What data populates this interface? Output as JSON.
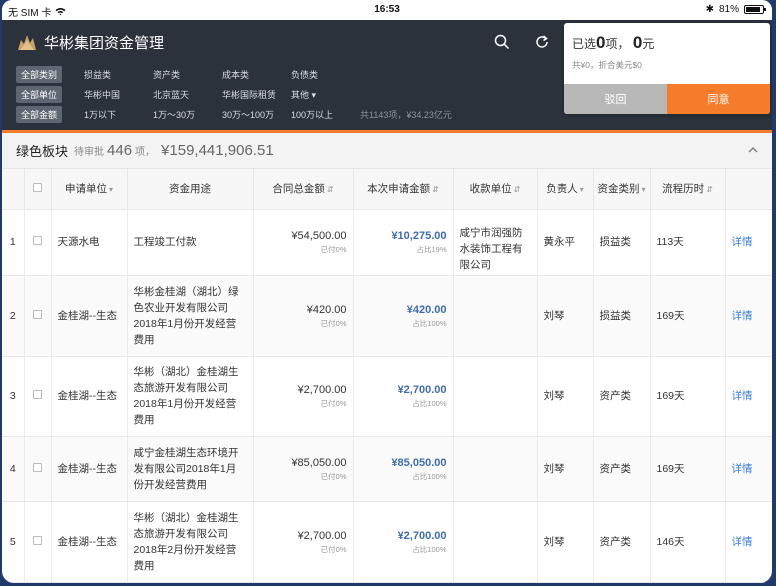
{
  "status": {
    "carrier": "无 SIM 卡",
    "time": "16:53",
    "battery": "81%"
  },
  "app": {
    "title": "华彬集团资金管理"
  },
  "filters": {
    "category": {
      "tag": "全部类别",
      "options": [
        "损益类",
        "资产类",
        "成本类",
        "负债类"
      ]
    },
    "unit": {
      "tag": "全部单位",
      "options": [
        "华彬中国",
        "北京蓝天",
        "华彬国际租赁",
        "其他"
      ]
    },
    "amount": {
      "tag": "全部金额",
      "options": [
        "1万以下",
        "1万～30万",
        "30万～100万",
        "100万以上"
      ],
      "summary": "共1143项，¥34.23亿元"
    }
  },
  "section": {
    "title": "绿色板块",
    "pending_label": "待审批",
    "count": "446",
    "unit": "项，",
    "amount": "¥159,441,906.51"
  },
  "table": {
    "headers": [
      "申请单位",
      "资金用途",
      "合同总金额",
      "本次申请金额",
      "收款单位",
      "负责人",
      "资金类别",
      "流程历时"
    ],
    "rows": [
      {
        "idx": "1",
        "unit": "天源水电",
        "purpose": "工程竣工付款",
        "total": "¥54,500.00",
        "paid": "已付0%",
        "req": "¥10,275.00",
        "ratio": "占比19%",
        "payee": "咸宁市润强防水装饰工程有限公司",
        "owner": "黄永平",
        "cat": "损益类",
        "days": "113天",
        "action": "详情"
      },
      {
        "idx": "2",
        "unit": "金桂湖--生态",
        "purpose": "华彬金桂湖（湖北）绿色农业开发有限公司2018年1月份开发经营费用",
        "total": "¥420.00",
        "paid": "已付0%",
        "req": "¥420.00",
        "ratio": "占比100%",
        "payee": "",
        "owner": "刘琴",
        "cat": "损益类",
        "days": "169天",
        "action": "详情"
      },
      {
        "idx": "3",
        "unit": "金桂湖--生态",
        "purpose": "华彬（湖北）金桂湖生态旅游开发有限公司2018年1月份开发经营费用",
        "total": "¥2,700.00",
        "paid": "已付0%",
        "req": "¥2,700.00",
        "ratio": "占比100%",
        "payee": "",
        "owner": "刘琴",
        "cat": "资产类",
        "days": "169天",
        "action": "详情"
      },
      {
        "idx": "4",
        "unit": "金桂湖--生态",
        "purpose": "咸宁金桂湖生态环境开发有限公司2018年1月份开发经营费用",
        "total": "¥85,050.00",
        "paid": "已付0%",
        "req": "¥85,050.00",
        "ratio": "占比100%",
        "payee": "",
        "owner": "刘琴",
        "cat": "资产类",
        "days": "169天",
        "action": "详情"
      },
      {
        "idx": "5",
        "unit": "金桂湖--生态",
        "purpose": "华彬（湖北）金桂湖生态旅游开发有限公司2018年2月份开发经营费用",
        "total": "¥2,700.00",
        "paid": "已付0%",
        "req": "¥2,700.00",
        "ratio": "占比100%",
        "payee": "",
        "owner": "刘琴",
        "cat": "资产类",
        "days": "146天",
        "action": "详情"
      }
    ]
  },
  "popup": {
    "prefix": "已选",
    "count": "0",
    "mid": "项，",
    "amount": "0",
    "suffix": "元",
    "sub": "共¥0，折合美元$0",
    "back_label": "驳回",
    "ok_label": "同意"
  },
  "colors": {
    "accent": "#f57c2b",
    "header_bg": "#2b323c",
    "link": "#3b7fd0",
    "amount_blue": "#3f6cab"
  }
}
